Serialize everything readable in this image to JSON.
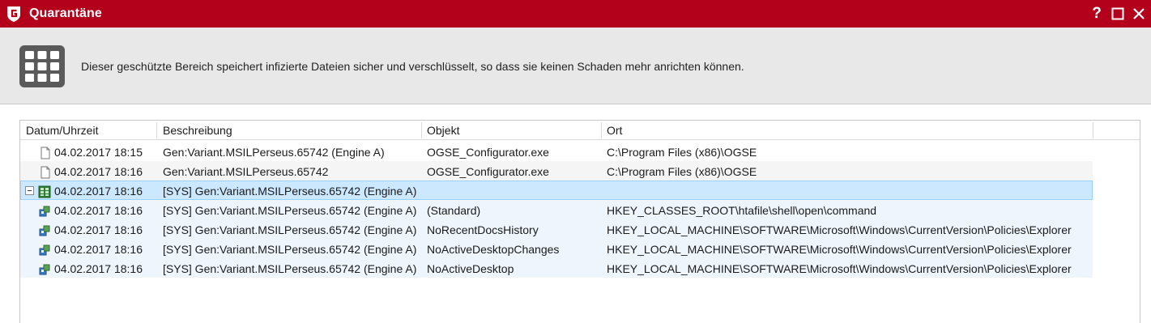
{
  "window": {
    "title": "Quarantäne",
    "help_glyph": "?",
    "maximize_glyph": "☐",
    "close_glyph": "✕",
    "brand_color": "#b3001b",
    "logo_icon": "gdata-g-shield-icon"
  },
  "header": {
    "icon": "grid-icon",
    "description": "Dieser geschützte Bereich speichert infizierte Dateien sicher und verschlüsselt, so dass sie keinen Schaden mehr anrichten können."
  },
  "table": {
    "columns": [
      "Datum/Uhrzeit",
      "Beschreibung",
      "Objekt",
      "Ort"
    ],
    "rows": [
      {
        "icon": "file-icon",
        "date": "04.02.2017 18:15",
        "description": "Gen:Variant.MSILPerseus.65742 (Engine A)",
        "object": "OGSE_Configurator.exe",
        "location": "C:\\Program Files (x86)\\OGSE"
      },
      {
        "icon": "file-icon",
        "date": "04.02.2017 18:16",
        "description": "Gen:Variant.MSILPerseus.65742",
        "object": "OGSE_Configurator.exe",
        "location": "C:\\Program Files (x86)\\OGSE"
      },
      {
        "icon": "registry-group-icon",
        "date": "04.02.2017 18:16",
        "description": "[SYS] Gen:Variant.MSILPerseus.65742 (Engine A)",
        "object": "",
        "location": ""
      },
      {
        "icon": "registry-value-icon",
        "date": "04.02.2017 18:16",
        "description": "[SYS] Gen:Variant.MSILPerseus.65742 (Engine A)",
        "object": "(Standard)",
        "location": "HKEY_CLASSES_ROOT\\htafile\\shell\\open\\command"
      },
      {
        "icon": "registry-value-icon",
        "date": "04.02.2017 18:16",
        "description": "[SYS] Gen:Variant.MSILPerseus.65742 (Engine A)",
        "object": "NoRecentDocsHistory",
        "location": "HKEY_LOCAL_MACHINE\\SOFTWARE\\Microsoft\\Windows\\CurrentVersion\\Policies\\Explorer"
      },
      {
        "icon": "registry-value-icon",
        "date": "04.02.2017 18:16",
        "description": "[SYS] Gen:Variant.MSILPerseus.65742 (Engine A)",
        "object": "NoActiveDesktopChanges",
        "location": "HKEY_LOCAL_MACHINE\\SOFTWARE\\Microsoft\\Windows\\CurrentVersion\\Policies\\Explorer"
      },
      {
        "icon": "registry-value-icon",
        "date": "04.02.2017 18:16",
        "description": "[SYS] Gen:Variant.MSILPerseus.65742 (Engine A)",
        "object": "NoActiveDesktop",
        "location": "HKEY_LOCAL_MACHINE\\SOFTWARE\\Microsoft\\Windows\\CurrentVersion\\Policies\\Explorer"
      }
    ]
  }
}
